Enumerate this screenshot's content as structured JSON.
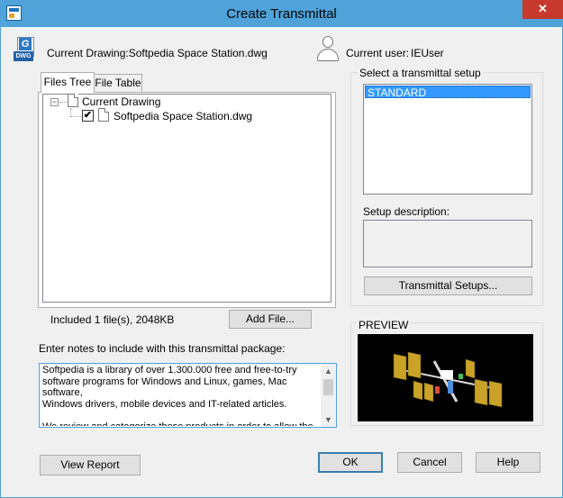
{
  "window": {
    "title": "Create Transmittal",
    "close_glyph": "✕"
  },
  "header": {
    "current_drawing": "Current Drawing:Softpedia Space Station.dwg",
    "file_icon_glyph": "G",
    "file_icon_tag": "DWG",
    "current_user_label": "Current user:",
    "current_user_value": "IEUser"
  },
  "tabs": [
    {
      "label": "Files Tree",
      "active": true
    },
    {
      "label": "File Table",
      "active": false
    }
  ],
  "tree": {
    "expander_glyph": "−",
    "root_label": "Current Drawing",
    "child_label": "Softpedia Space Station.dwg",
    "child_checked_glyph": "✔"
  },
  "status": {
    "included_text": "Included 1 file(s), 2048KB"
  },
  "buttons": {
    "add_file": "Add File...",
    "transmittal_setups": "Transmittal Setups...",
    "view_report": "View Report",
    "ok": "OK",
    "cancel": "Cancel",
    "help": "Help"
  },
  "notes": {
    "label": "Enter notes to include with this transmittal package:",
    "value": "Softpedia is a library of over 1.300.000 free and free-to-try\nsoftware programs for Windows and Linux, games, Mac software,\nWindows drivers, mobile devices and IT-related articles.\n\nWe review and categorize these products in order to allow the",
    "scroll_up_glyph": "▲",
    "scroll_down_glyph": "▼"
  },
  "setup": {
    "group_label": "Select a transmittal setup",
    "items": [
      "STANDARD"
    ],
    "selected": "STANDARD",
    "description_label": "Setup description:",
    "description_value": ""
  },
  "preview": {
    "label": "PREVIEW",
    "background_color": "#000000",
    "panel_color": "#c9a227",
    "truss_color": "#d9d9d9"
  },
  "colors": {
    "titlebar": "#4fa3d9",
    "close_button": "#c7392c",
    "selection": "#3399ff",
    "window_bg": "#f0f0f0"
  },
  "icons": {
    "app": "transmittal-app-icon",
    "file": "dwg-file-icon",
    "user": "user-silhouette-icon",
    "document": "document-icon"
  }
}
